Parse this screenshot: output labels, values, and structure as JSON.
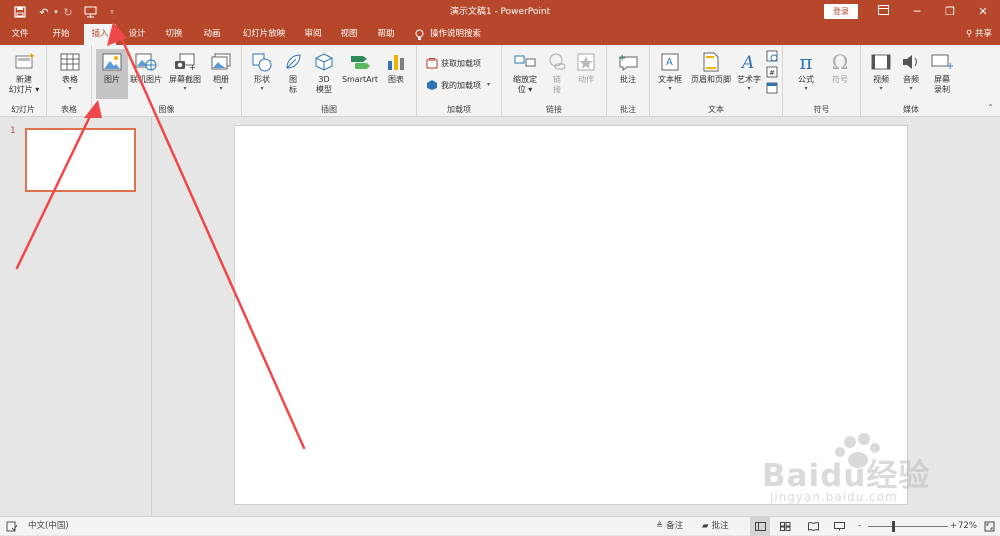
{
  "window": {
    "title": "演示文稿1  -  PowerPoint",
    "login": "登录"
  },
  "tabs": [
    {
      "label": "文件"
    },
    {
      "label": "开始"
    },
    {
      "label": "插入"
    },
    {
      "label": "设计"
    },
    {
      "label": "切换"
    },
    {
      "label": "动画"
    },
    {
      "label": "幻灯片放映"
    },
    {
      "label": "审阅"
    },
    {
      "label": "视图"
    },
    {
      "label": "帮助"
    },
    {
      "label": "操作说明搜索"
    }
  ],
  "share": "共享",
  "ribbon": {
    "groups": {
      "slides": "幻灯片",
      "tables": "表格",
      "images": "图像",
      "illustrations": "插图",
      "addins": "加载项",
      "links": "链接",
      "comments": "批注",
      "text": "文本",
      "symbols": "符号",
      "media": "媒体"
    },
    "new_slide": [
      "新建",
      "幻灯片 ▾"
    ],
    "table": "表格",
    "picture": "图片",
    "online_picture": "联机图片",
    "screenshot": "屏幕截图",
    "album": "相册",
    "shapes": "形状",
    "icons": [
      "图",
      "标"
    ],
    "model3d": [
      "3D",
      "模型"
    ],
    "smartart": "SmartArt",
    "chart": "图表",
    "get_addins": "获取加载项",
    "my_addins": "我的加载项",
    "zoom": [
      "缩放定",
      "位 ▾"
    ],
    "link": [
      "链",
      "接"
    ],
    "action": "动作",
    "comment": "批注",
    "textbox": "文本框",
    "header_footer": "页眉和页脚",
    "wordart": "艺术字",
    "equation": "公式",
    "symbol": "符号",
    "video": "视频",
    "audio": "音频",
    "screen_rec": [
      "屏幕",
      "录制"
    ]
  },
  "thumbnail": {
    "number": "1"
  },
  "status": {
    "language": "中文(中国)",
    "notes": "备注",
    "comments": "批注",
    "zoom": "72%",
    "zoom_minus": "-",
    "zoom_plus": "+"
  },
  "watermark": {
    "brand": "Baidu经验",
    "url": "jingyan.baidu.com"
  },
  "colors": {
    "accent": "#b7472a",
    "annotation": "#ee4444"
  }
}
